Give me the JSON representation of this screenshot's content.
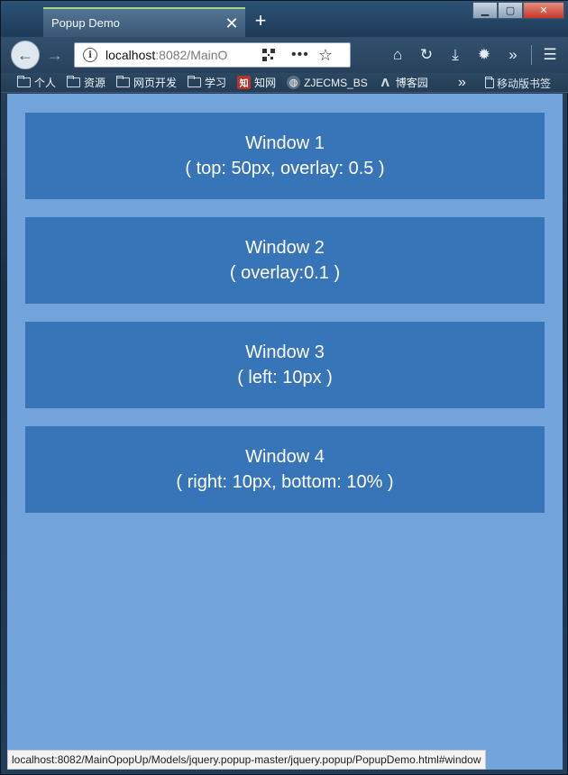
{
  "browser": {
    "tab_title": "Popup Demo",
    "tab_close": "✕",
    "new_tab": "+",
    "window_controls": {
      "minimize": "▁",
      "maximize": "▢",
      "close": "✕"
    },
    "url_host": "localhost",
    "url_rest": ":8082/MainO",
    "bookmarks": [
      {
        "label": "个人",
        "icon": "folder-icon"
      },
      {
        "label": "资源",
        "icon": "folder-icon"
      },
      {
        "label": "网页开发",
        "icon": "folder-icon"
      },
      {
        "label": "学习",
        "icon": "folder-icon"
      },
      {
        "label": "知网",
        "icon": "zhiwang-icon",
        "badge_text": "知",
        "badge_color": "#b8332b"
      },
      {
        "label": "ZJECMS_BS",
        "icon": "globe-icon"
      },
      {
        "label": "博客园",
        "icon": "cnblogs-icon"
      }
    ],
    "bookmarks_overflow": "»",
    "mobile_bookmarks": "移动版书签",
    "status_url": "localhost:8082/MainOpopUp/Models/jquery.popup-master/jquery.popup/PopupDemo.html#window"
  },
  "windows": [
    {
      "title": "Window 1",
      "subtitle": "( top: 50px, overlay: 0.5 )"
    },
    {
      "title": "Window 2",
      "subtitle": "( overlay:0.1 )"
    },
    {
      "title": "Window 3",
      "subtitle": "( left: 10px )"
    },
    {
      "title": "Window 4",
      "subtitle": "( right: 10px, bottom: 10% )"
    }
  ],
  "colors": {
    "page_background": "#72a4db",
    "card_background": "#3874b8",
    "card_text": "#ffffff"
  }
}
